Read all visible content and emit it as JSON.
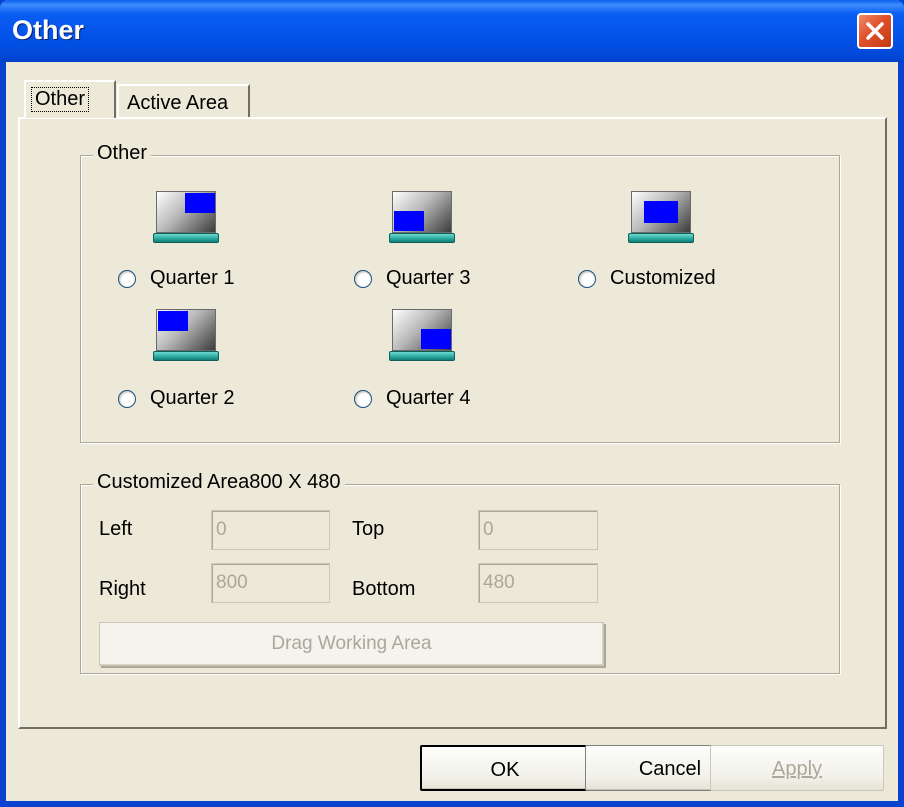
{
  "window": {
    "title": "Other"
  },
  "tabs": [
    {
      "label": "Other",
      "selected": true
    },
    {
      "label": "Active Area",
      "selected": false
    }
  ],
  "group_other": {
    "legend": "Other",
    "options": [
      {
        "label": "Quarter 1",
        "icon": "monitor-quarter1-icon"
      },
      {
        "label": "Quarter 3",
        "icon": "monitor-quarter3-icon"
      },
      {
        "label": "Customized",
        "icon": "monitor-customized-icon"
      },
      {
        "label": "Quarter 2",
        "icon": "monitor-quarter2-icon"
      },
      {
        "label": "Quarter 4",
        "icon": "monitor-quarter4-icon"
      }
    ]
  },
  "group_custom": {
    "legend": "Customized Area800 X 480",
    "left_label": "Left",
    "left_value": "0",
    "top_label": "Top",
    "top_value": "0",
    "right_label": "Right",
    "right_value": "800",
    "bottom_label": "Bottom",
    "bottom_value": "480",
    "drag_button": "Drag Working Area"
  },
  "buttons": {
    "ok": "OK",
    "cancel": "Cancel",
    "apply": "Apply"
  },
  "colors": {
    "titlebar": "#0a5ef4",
    "window_bg": "#ece9d8",
    "screen_highlight": "#0000ff",
    "disabled_text": "#aca899"
  }
}
